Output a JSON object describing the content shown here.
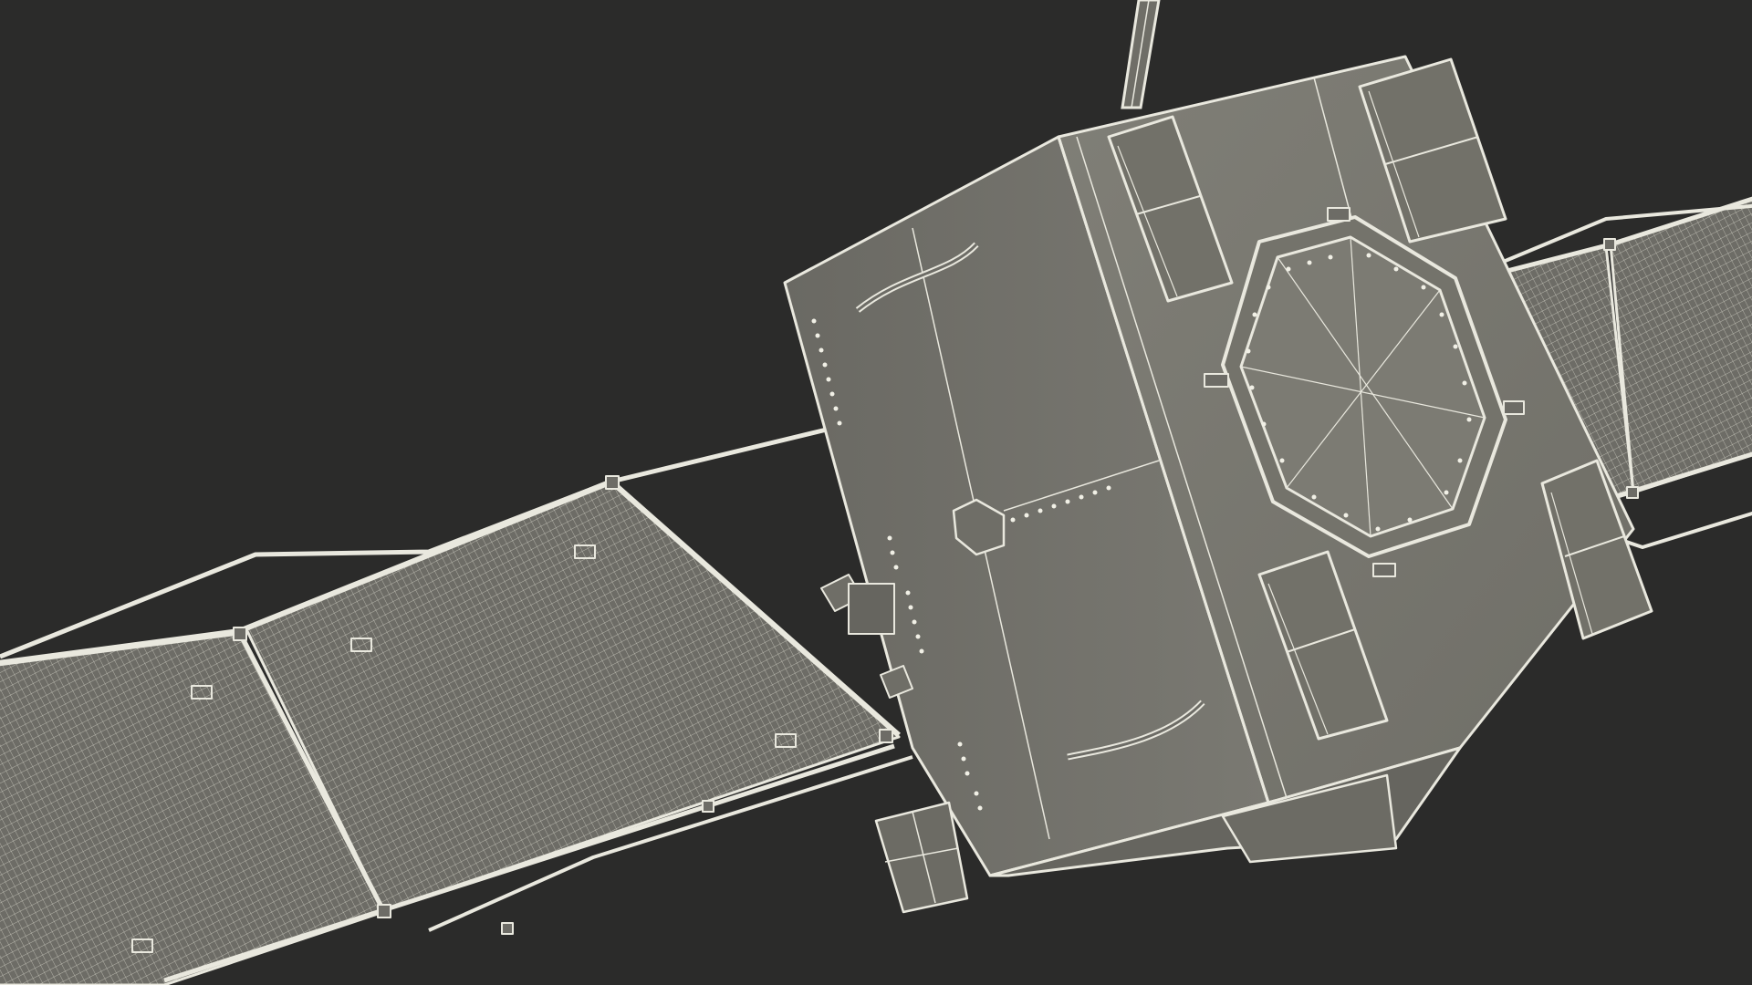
{
  "scene": {
    "subject_icon": "satellite-wireframe-render",
    "background_color": "#2b2b2a",
    "body_color": "#77766d",
    "panel_color": "#6d6c66",
    "wire_color": "#e9e8de"
  }
}
